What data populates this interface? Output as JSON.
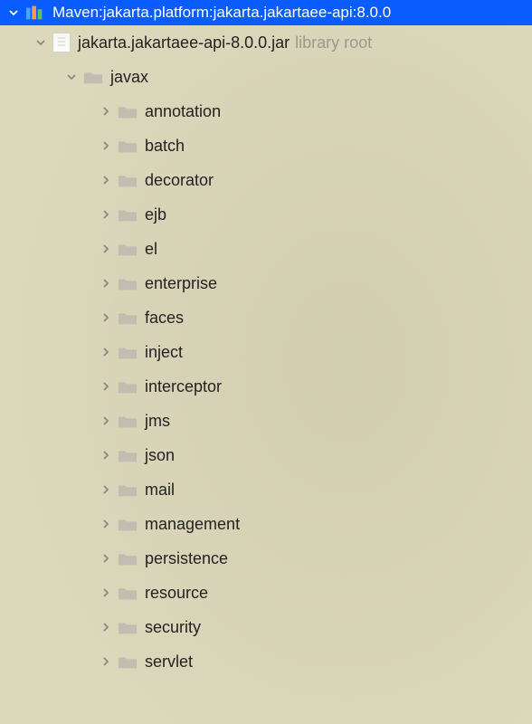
{
  "root": {
    "prefix": "Maven: ",
    "artifact": "jakarta.platform:jakarta.jakartaee-api:8.0.0"
  },
  "jar": {
    "name": "jakarta.jakartaee-api-8.0.0.jar",
    "suffix": "library root"
  },
  "pkg_root": "javax",
  "packages": [
    "annotation",
    "batch",
    "decorator",
    "ejb",
    "el",
    "enterprise",
    "faces",
    "inject",
    "interceptor",
    "jms",
    "json",
    "mail",
    "management",
    "persistence",
    "resource",
    "security",
    "servlet"
  ],
  "colors": {
    "selection": "#0a5cff",
    "folder": "#c1bdb0"
  }
}
